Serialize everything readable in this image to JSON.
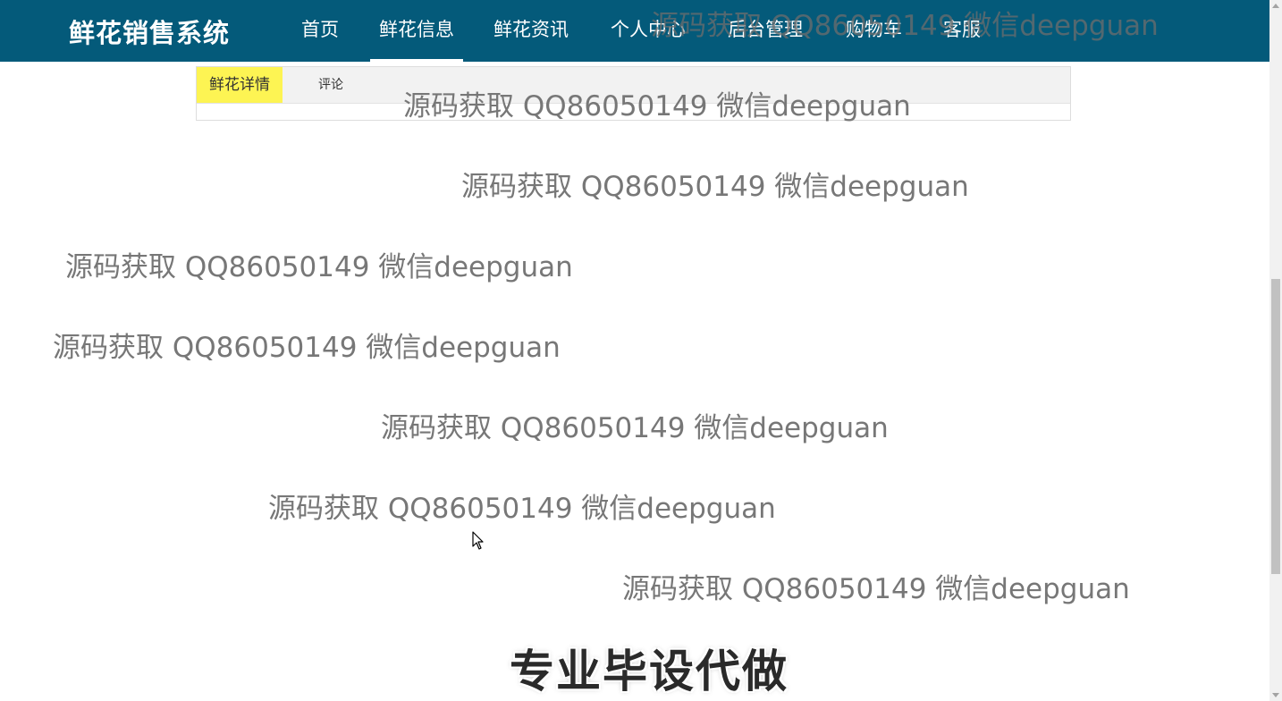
{
  "app": {
    "title": "鲜花销售系统"
  },
  "nav": {
    "items": [
      {
        "label": "首页"
      },
      {
        "label": "鲜花信息",
        "active": true
      },
      {
        "label": "鲜花资讯"
      },
      {
        "label": "个人中心"
      },
      {
        "label": "后台管理"
      },
      {
        "label": "购物车"
      },
      {
        "label": "客服"
      }
    ]
  },
  "tabs": [
    {
      "label": "鲜花详情",
      "active": true
    },
    {
      "label": "评论"
    }
  ],
  "watermark": {
    "text": "源码获取 QQ86050149 微信deepguan",
    "stamp": "专业毕设代做"
  },
  "colors": {
    "navbar": "#045a7a",
    "active_tab": "#fdf453"
  },
  "icons": [
    "mouse-pointer-icon",
    "scroll-up-arrow-icon",
    "scroll-down-arrow-icon"
  ]
}
